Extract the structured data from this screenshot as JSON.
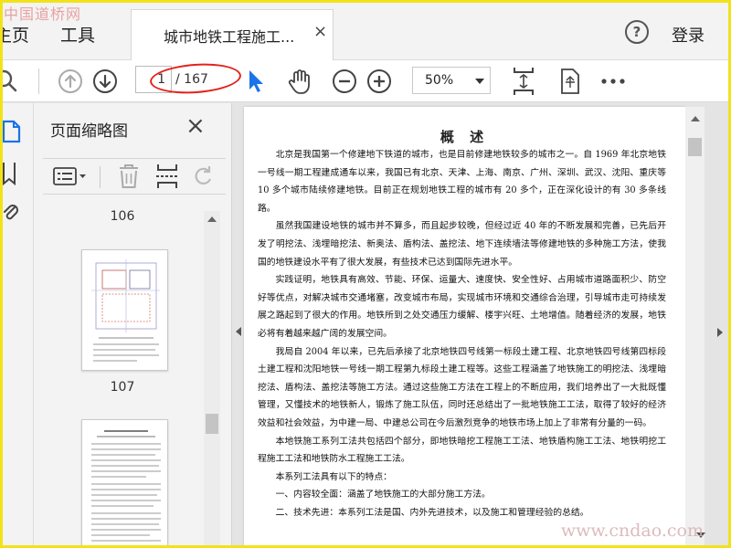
{
  "watermark_top": "中国道桥网",
  "watermark_bottom": "www.cndao.com",
  "menu": {
    "home": "主页",
    "tools": "工具",
    "tab_title": "城市地铁工程施工...",
    "tab_close": "×",
    "help": "?",
    "login": "登录"
  },
  "toolbar": {
    "page_current": "1",
    "page_total": "/ 167",
    "zoom": "50%"
  },
  "panel": {
    "title": "页面缩略图",
    "close": "×",
    "thumbnails": [
      {
        "label": "106"
      },
      {
        "label": "107"
      }
    ]
  },
  "doc": {
    "title": "概 述",
    "paragraphs": [
      "北京是我国第一个修建地下铁道的城市，也是目前修建地铁较多的城市之一。自 1969 年北京地铁一号线一期工程建成通车以来，我国已有北京、天津、上海、南京、广州、深圳、武汉、沈阳、重庆等 10 多个城市陆续修建地铁。目前正在规划地铁工程的城市有 20 多个，正在深化设计的有 30 多条线路。",
      "虽然我国建设地铁的城市并不算多，而且起步较晚，但经过近 40 年的不断发展和完善，已先后开发了明挖法、浅埋暗挖法、新奥法、盾构法、盖挖法、地下连续墙法等修建地铁的多种施工方法，使我国的地铁建设水平有了很大发展，有些技术已达到国际先进水平。",
      "实践证明，地铁具有高效、节能、环保、运量大、速度快、安全性好、占用城市道路面积少、防空好等优点，对解决城市交通堵塞，改变城市布局，实现城市环境和交通综合治理，引导城市走可持续发展之路起到了很大的作用。地铁所到之处交通压力缓解、楼宇兴旺、土地增值。随着经济的发展，地铁必将有着越来越广阔的发展空间。",
      "我局自 2004 年以来，已先后承接了北京地铁四号线第一标段土建工程、北京地铁四号线第四标段土建工程和沈阳地铁一号线一期工程第九标段土建工程等。这些工程涵盖了地铁施工的明挖法、浅埋暗挖法、盾构法、盖挖法等施工方法。通过这些施工方法在工程上的不断应用，我们培养出了一大批既懂管理，又懂技术的地铁新人，锻炼了施工队伍，同时还总结出了一批地铁施工工法，取得了较好的经济效益和社会效益，为中建一局、中建总公司在今后激烈竞争的地铁市场上加上了非常有分量的一码。",
      "本地铁施工系列工法共包括四个部分，即地铁暗挖工程施工工法、地铁盾构施工工法、地铁明挖工程施工工法和地铁防水工程施工工法。",
      "本系列工法具有以下的特点：",
      "一、内容较全面：涵盖了地铁施工的大部分施工方法。",
      "二、技术先进：本系列工法是国、内外先进技术，以及施工和管理经验的总结。"
    ]
  }
}
